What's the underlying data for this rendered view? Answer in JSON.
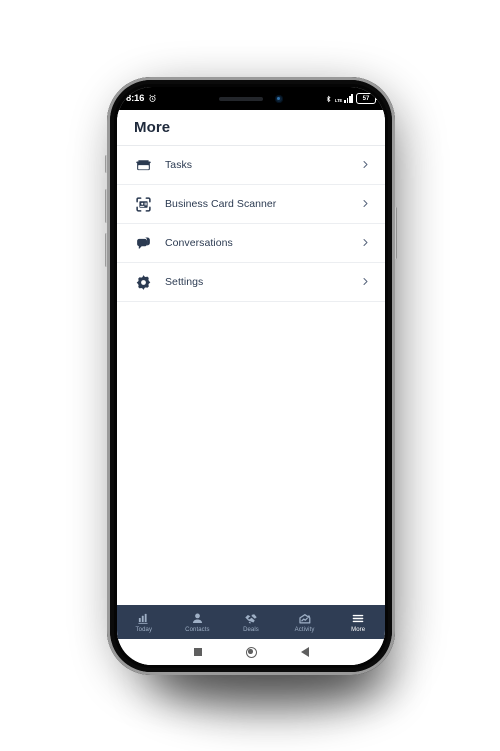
{
  "device": {
    "frame_color": "#050505",
    "rim_color": "#9a9a9a",
    "buttons": [
      "mute-switch",
      "volume-up-button",
      "volume-down-button",
      "power-button"
    ]
  },
  "status_bar": {
    "time": "8:16",
    "alarm_icon": "alarm-clock-icon",
    "bluetooth_icon": "bluetooth-icon",
    "network_type": "LTE",
    "signal_icon": "signal-bars-icon",
    "battery_percent": "57"
  },
  "app_bar": {
    "title": "More"
  },
  "menu": {
    "items": [
      {
        "label": "Tasks",
        "icon": "tasks-tray-icon",
        "chevron": "chevron-right-icon"
      },
      {
        "label": "Business Card Scanner",
        "icon": "card-scanner-icon",
        "chevron": "chevron-right-icon"
      },
      {
        "label": "Conversations",
        "icon": "chat-bubbles-icon",
        "chevron": "chevron-right-icon"
      },
      {
        "label": "Settings",
        "icon": "gear-icon",
        "chevron": "chevron-right-icon"
      }
    ]
  },
  "tab_bar": {
    "background": "#2f3d54",
    "active_color": "#ffffff",
    "inactive_color": "#9fb0c6",
    "tabs": [
      {
        "label": "Today",
        "icon": "bar-chart-icon",
        "active": false
      },
      {
        "label": "Contacts",
        "icon": "person-icon",
        "active": false
      },
      {
        "label": "Deals",
        "icon": "handshake-icon",
        "active": false
      },
      {
        "label": "Activity",
        "icon": "activity-house-icon",
        "active": false
      },
      {
        "label": "More",
        "icon": "hamburger-menu-icon",
        "active": true
      }
    ]
  },
  "system_nav": {
    "recents": "recents-square-button",
    "home": "home-circle-button",
    "back": "back-triangle-button"
  }
}
